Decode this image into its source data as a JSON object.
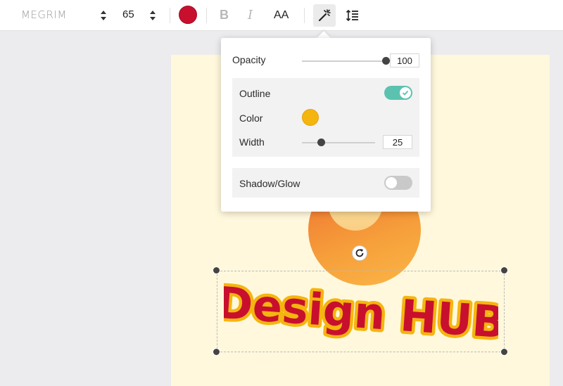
{
  "toolbar": {
    "font_name": "MEGRIM",
    "font_size": "65",
    "text_color": "#c8102e",
    "bold_label": "B",
    "italic_label": "I",
    "case_label": "AA",
    "effects_icon": "magic-wand-icon",
    "spacing_icon": "line-spacing-icon"
  },
  "effects": {
    "opacity_label": "Opacity",
    "opacity_value": "100",
    "opacity_fraction": 1.0,
    "outline_label": "Outline",
    "outline_enabled": true,
    "color_label": "Color",
    "outline_color": "#f5b50f",
    "width_label": "Width",
    "width_value": "25",
    "width_fraction": 0.25,
    "shadow_label": "Shadow/Glow",
    "shadow_enabled": false
  },
  "canvas": {
    "text": "Design HUB",
    "text_color": "#c8102e",
    "outline_color": "#f5b50f",
    "background_color": "#fff8dc",
    "rotate_icon": "rotate-icon"
  },
  "colors": {
    "toggle_on": "#5bc2b0",
    "toggle_off": "#c9c9c9"
  }
}
